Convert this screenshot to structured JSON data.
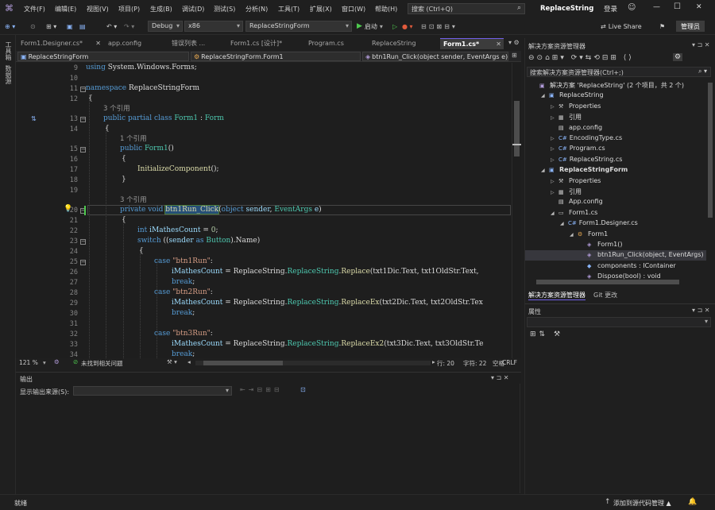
{
  "menu": [
    "文件(F)",
    "编辑(E)",
    "视图(V)",
    "项目(P)",
    "生成(B)",
    "调试(D)",
    "测试(S)",
    "分析(N)",
    "工具(T)",
    "扩展(X)",
    "窗口(W)",
    "帮助(H)"
  ],
  "search_placeholder": "搜索 (Ctrl+Q)",
  "solution_name": "ReplaceString",
  "login": "登录",
  "window_controls": [
    "—",
    "☐",
    "✕"
  ],
  "toolbar": {
    "config": "Debug",
    "platform": "x86",
    "project": "ReplaceStringForm",
    "start": "启动",
    "live_share": "Live Share",
    "admin": "管理员"
  },
  "left_tools": [
    "工具箱",
    "数据源"
  ],
  "tabs": [
    "Form1.Designer.cs*",
    "app.config",
    "错误列表 ...",
    "Form1.cs [设计]*",
    "Program.cs",
    "ReplaceString",
    "Form1.cs*"
  ],
  "nav": {
    "project": "ReplaceStringForm",
    "class": "ReplaceStringForm.Form1",
    "member": "btn1Run_Click(object sender, EventArgs e)"
  },
  "code_lines": [
    {
      "n": "9",
      "t": "using System.Windows.Forms;"
    },
    {
      "n": "10",
      "t": ""
    },
    {
      "n": "11",
      "t": "namespace ReplaceStringForm"
    },
    {
      "n": "12",
      "t": "{"
    },
    {
      "n": "",
      "t": "3 个引用"
    },
    {
      "n": "13",
      "t": "public partial class Form1 : Form"
    },
    {
      "n": "14",
      "t": "{"
    },
    {
      "n": "",
      "t": "1 个引用"
    },
    {
      "n": "15",
      "t": "public Form1()"
    },
    {
      "n": "16",
      "t": "{"
    },
    {
      "n": "17",
      "t": "InitializeComponent();"
    },
    {
      "n": "18",
      "t": "}"
    },
    {
      "n": "19",
      "t": ""
    },
    {
      "n": "",
      "t": "3 个引用"
    },
    {
      "n": "20",
      "t": "private void btn1Run_Click(object sender, EventArgs e)"
    },
    {
      "n": "21",
      "t": "{"
    },
    {
      "n": "22",
      "t": "int iMathesCount = 0;"
    },
    {
      "n": "23",
      "t": "switch ((sender as Button).Name)"
    },
    {
      "n": "24",
      "t": "{"
    },
    {
      "n": "25",
      "t": "case \"btn1Run\":"
    },
    {
      "n": "26",
      "t": "iMathesCount = ReplaceString.ReplaceString.Replace(txt1Dic.Text, txt1OldStr.Text,"
    },
    {
      "n": "27",
      "t": "break;"
    },
    {
      "n": "28",
      "t": "case \"btn2Run\":"
    },
    {
      "n": "29",
      "t": "iMathesCount = ReplaceString.ReplaceString.ReplaceEx(txt2Dic.Text, txt2OldStr.Tex"
    },
    {
      "n": "30",
      "t": "break;"
    },
    {
      "n": "31",
      "t": ""
    },
    {
      "n": "32",
      "t": "case \"btn3Run\":"
    },
    {
      "n": "33",
      "t": "iMathesCount = ReplaceString.ReplaceString.ReplaceEx2(txt3Dic.Text, txt3OldStr.Te"
    },
    {
      "n": "34",
      "t": "break;"
    }
  ],
  "status_line": {
    "zoom": "121 %",
    "issues": "未找到相关问题",
    "line": "行: 20",
    "col": "字符: 22",
    "ws": "空格",
    "eol": "CRLF"
  },
  "output": {
    "title": "输出",
    "source_label": "显示输出来源(S):"
  },
  "solution_explorer": {
    "title": "解决方案资源管理器",
    "search": "搜索解决方案资源管理器(Ctrl+;)",
    "items": [
      {
        "label": "解决方案 'ReplaceString' (2 个项目，共 2 个)",
        "indent": 0,
        "icon": "solution",
        "bold": false
      },
      {
        "label": "ReplaceString",
        "indent": 1,
        "icon": "project",
        "bold": false
      },
      {
        "label": "Properties",
        "indent": 2,
        "icon": "wrench",
        "bold": false
      },
      {
        "label": "引用",
        "indent": 2,
        "icon": "ref",
        "bold": false
      },
      {
        "label": "app.config",
        "indent": 2,
        "icon": "config",
        "bold": false
      },
      {
        "label": "EncodingType.cs",
        "indent": 2,
        "icon": "cs",
        "bold": false
      },
      {
        "label": "Program.cs",
        "indent": 2,
        "icon": "cs",
        "bold": false
      },
      {
        "label": "ReplaceString.cs",
        "indent": 2,
        "icon": "cs",
        "bold": false
      },
      {
        "label": "ReplaceStringForm",
        "indent": 1,
        "icon": "project",
        "bold": true
      },
      {
        "label": "Properties",
        "indent": 2,
        "icon": "wrench",
        "bold": false
      },
      {
        "label": "引用",
        "indent": 2,
        "icon": "ref",
        "bold": false
      },
      {
        "label": "App.config",
        "indent": 2,
        "icon": "config",
        "bold": false
      },
      {
        "label": "Form1.cs",
        "indent": 2,
        "icon": "form",
        "bold": false
      },
      {
        "label": "Form1.Designer.cs",
        "indent": 3,
        "icon": "cs",
        "bold": false
      },
      {
        "label": "Form1",
        "indent": 4,
        "icon": "class",
        "bold": false
      },
      {
        "label": "Form1()",
        "indent": 5,
        "icon": "method",
        "bold": false
      },
      {
        "label": "btn1Run_Click(object, EventArgs) : v",
        "indent": 5,
        "icon": "method",
        "bold": false
      },
      {
        "label": "components : IContainer",
        "indent": 5,
        "icon": "field",
        "bold": false
      },
      {
        "label": "Dispose(bool) : void",
        "indent": 5,
        "icon": "method",
        "bold": false
      }
    ],
    "tabs": [
      "解决方案资源管理器",
      "Git 更改"
    ]
  },
  "properties": {
    "title": "属性"
  },
  "bottom": {
    "ready": "就绪",
    "source_control": "添加到源代码管理 ▲"
  },
  "colors": {
    "accent": "#7160e8",
    "bg": "#1f1f1f",
    "editor_bg": "#1e1e1e",
    "start": "#4ec94e"
  }
}
